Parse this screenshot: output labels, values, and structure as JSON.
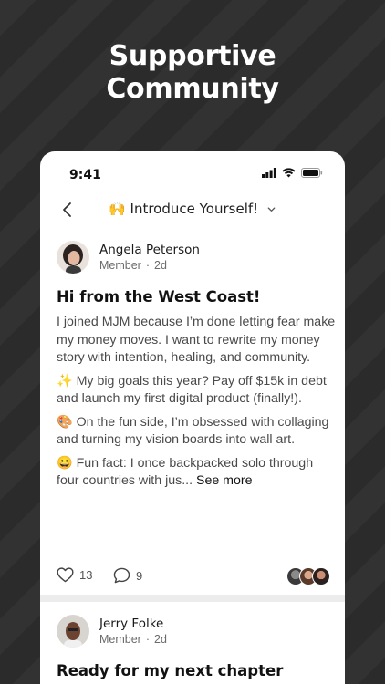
{
  "headline": "Supportive\nCommunity",
  "status_bar": {
    "time": "9:41"
  },
  "nav": {
    "channel_emoji": "🙌",
    "channel_name": "Introduce Yourself!"
  },
  "posts": [
    {
      "author": "Angela Peterson",
      "role": "Member",
      "age": "2d",
      "title": "Hi from the West Coast!",
      "paragraphs": [
        "I joined MJM because I’m done letting fear make my money moves. I want to rewrite my money story with intention, healing, and community.",
        "✨ My big goals this year? Pay off $15k in debt and launch my first digital product (finally!).",
        "🎨 On the fun side, I’m obsessed with collaging and turning my vision boards into wall art.",
        "😀 Fun fact: I once backpacked solo through four countries with jus..."
      ],
      "see_more": "See more",
      "likes": "13",
      "comments": "9"
    },
    {
      "author": "Jerry Folke",
      "role": "Member",
      "age": "2d",
      "title": "Ready for my next chapter"
    }
  ],
  "colors": {
    "background": "#2b2b2b",
    "card": "#ffffff",
    "text": "#111111",
    "muted": "#6b6b6b"
  }
}
